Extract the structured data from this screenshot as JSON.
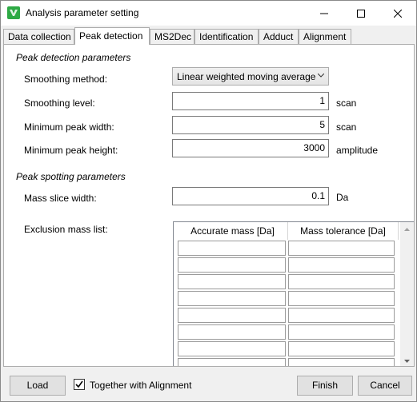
{
  "window": {
    "title": "Analysis parameter setting",
    "controls": {
      "minimize_icon": "minimize-icon",
      "maximize_icon": "maximize-icon",
      "close_icon": "close-icon"
    },
    "accent": "#2eaa45"
  },
  "tabs": [
    {
      "label": "Data collection",
      "active": false
    },
    {
      "label": "Peak detection",
      "active": true
    },
    {
      "label": "MS2Dec",
      "active": false
    },
    {
      "label": "Identification",
      "active": false
    },
    {
      "label": "Adduct",
      "active": false
    },
    {
      "label": "Alignment",
      "active": false
    }
  ],
  "peak_detection": {
    "section_title": "Peak detection parameters",
    "smoothing_method": {
      "label": "Smoothing method:",
      "value": "Linear weighted moving average"
    },
    "smoothing_level": {
      "label": "Smoothing level:",
      "value": "1",
      "unit": "scan"
    },
    "min_peak_width": {
      "label": "Minimum peak width:",
      "value": "5",
      "unit": "scan"
    },
    "min_peak_height": {
      "label": "Minimum peak height:",
      "value": "3000",
      "unit": "amplitude"
    }
  },
  "peak_spotting": {
    "section_title": "Peak spotting parameters",
    "mass_slice_width": {
      "label": "Mass slice width:",
      "value": "0.1",
      "unit": "Da"
    },
    "exclusion_list": {
      "label": "Exclusion mass list:",
      "columns": [
        "Accurate mass [Da]",
        "Mass tolerance [Da]"
      ],
      "rows": [
        [
          "",
          ""
        ],
        [
          "",
          ""
        ],
        [
          "",
          ""
        ],
        [
          "",
          ""
        ],
        [
          "",
          ""
        ],
        [
          "",
          ""
        ],
        [
          "",
          ""
        ],
        [
          "",
          ""
        ]
      ]
    }
  },
  "footer": {
    "load_label": "Load",
    "together_label": "Together with Alignment",
    "together_checked": true,
    "finish_label": "Finish",
    "cancel_label": "Cancel"
  }
}
